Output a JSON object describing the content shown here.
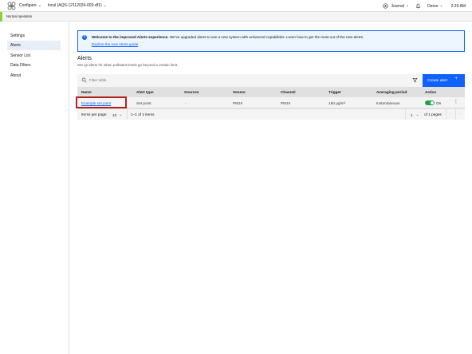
{
  "header": {
    "logo": "app-logo-icon",
    "configure_label": "Configure",
    "device_label": "local (AQS-12112024-003-df1)",
    "journal_label": "Journal",
    "user_label": "Demo",
    "time": "2:29 AM"
  },
  "status": {
    "text": "Normal operation",
    "color": "#8dd13a"
  },
  "sidebar": {
    "items": [
      {
        "label": "Settings",
        "active": false
      },
      {
        "label": "Alerts",
        "active": true
      },
      {
        "label": "Sensor List",
        "active": false
      },
      {
        "label": "Data Filters",
        "active": false
      },
      {
        "label": "About",
        "active": false
      }
    ]
  },
  "banner": {
    "title": "Welcome to the improved Alerts experience.",
    "message": " We've upgraded alerts to use a new system with enhanced capabilities. Learn how to get the most out of the new alerts.",
    "link": "Explore the new Alerts guide"
  },
  "page": {
    "title": "Alerts",
    "subtitle": "Set up alerts for when pollutant levels go beyond a certain limit."
  },
  "toolbar": {
    "search_placeholder": "Filter table",
    "create_label": "Create alert",
    "create_icon": "+"
  },
  "table": {
    "headers": [
      "Name",
      "Alert type",
      "Sources",
      "Sensor",
      "Channel",
      "Trigger",
      "Averaging period",
      "Active"
    ],
    "rows": [
      {
        "name": "Example set point",
        "alert_type": "Set point",
        "sources": "-",
        "sensor": "PM10",
        "channel": "PM10",
        "trigger": "150 µg/m³",
        "averaging": "Instantaneous",
        "active_label": "On",
        "active": true
      }
    ]
  },
  "pagination": {
    "items_per_page_label": "Items per page:",
    "items_per_page": "10",
    "range": "1–1 of 1 items",
    "page": "1",
    "of_pages": "of 1 pages"
  },
  "colors": {
    "accent": "#0f62fe",
    "toggle_on": "#24a148",
    "highlight": "#b3211b"
  }
}
